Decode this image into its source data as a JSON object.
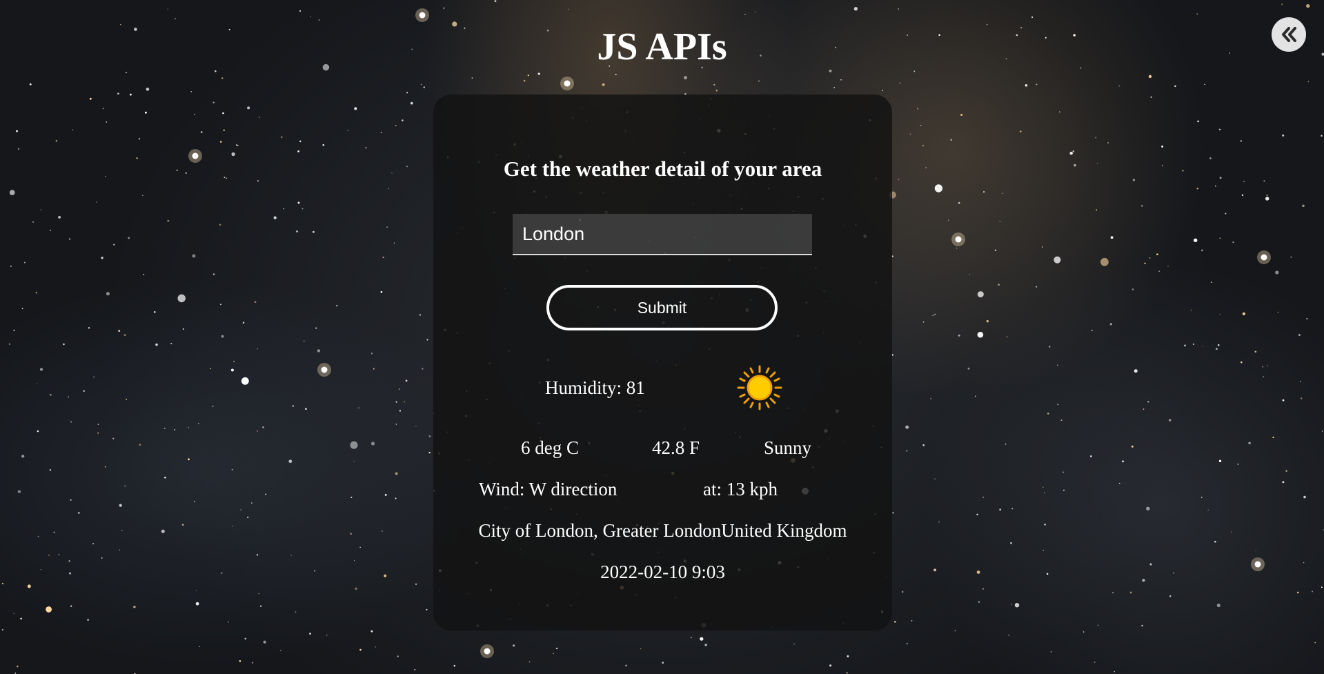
{
  "page": {
    "title": "JS APIs"
  },
  "collapse_button": {
    "icon": "double-chevron-left-icon"
  },
  "weather_card": {
    "heading": "Get the weather detail of your area",
    "input": {
      "value": "London",
      "placeholder": ""
    },
    "submit_label": "Submit",
    "humidity": "Humidity: 81",
    "condition_icon": "sun-icon",
    "temp_c": "6 deg C",
    "temp_f": "42.8 F",
    "condition": "Sunny",
    "wind_direction": "Wind: W direction",
    "wind_speed": "at: 13 kph",
    "location": "City of London, Greater LondonUnited Kingdom",
    "local_time": "2022-02-10 9:03"
  },
  "colors": {
    "text": "#ffffff",
    "card_bg": "#121212",
    "sun_fill": "#ffcc00",
    "sun_stroke": "#f0a000"
  }
}
